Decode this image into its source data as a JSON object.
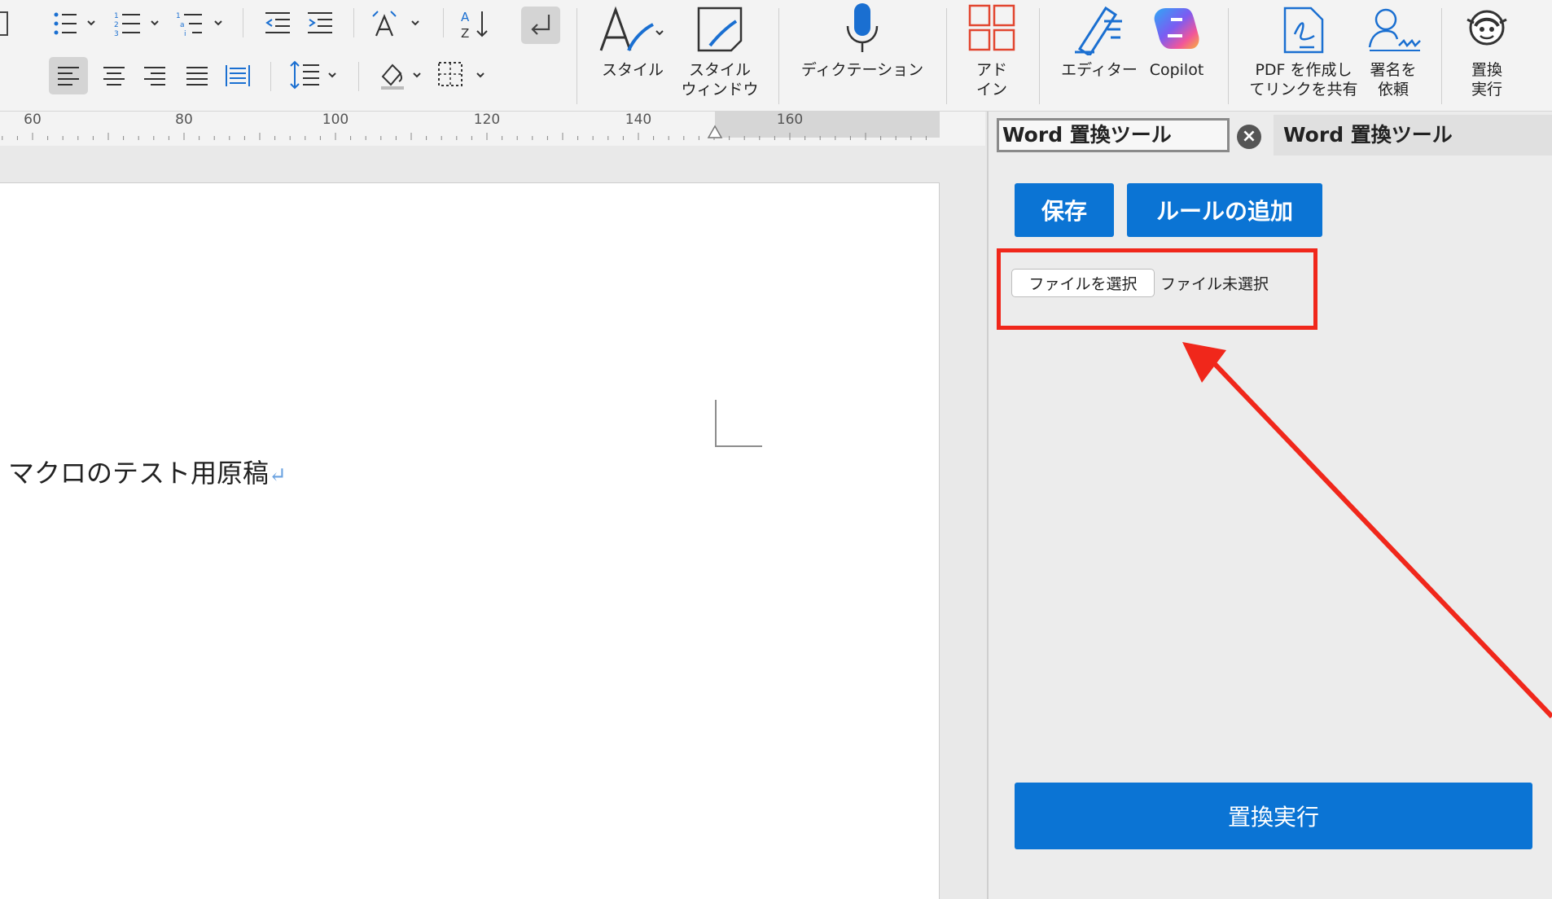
{
  "ribbon": {
    "style_label": "スタイル",
    "style_window_label": "スタイル\nウィンドウ",
    "dictation_label": "ディクテーション",
    "addin_label": "アド\nイン",
    "editor_label": "エディター",
    "copilot_label": "Copilot",
    "pdf_share_label": "PDF を作成し\nてリンクを共有",
    "sign_label": "署名を\n依頼",
    "replace_run_label": "置換\n実行"
  },
  "ruler": {
    "marks": [
      "60",
      "80",
      "100",
      "120",
      "140",
      "160"
    ]
  },
  "document": {
    "text": "マクロのテスト用原稿",
    "paragraph_mark": "↵"
  },
  "taskpane": {
    "active_tab": "Word 置換ツール",
    "inactive_tab": "Word 置換ツール",
    "close_glyph": "×",
    "save_button": "保存",
    "add_rule_button": "ルールの追加",
    "file_button": "ファイルを選択",
    "file_status": "ファイル未選択",
    "run_button": "置換実行"
  },
  "colors": {
    "accent": "#0b74d4",
    "annotation": "#f0271b"
  }
}
